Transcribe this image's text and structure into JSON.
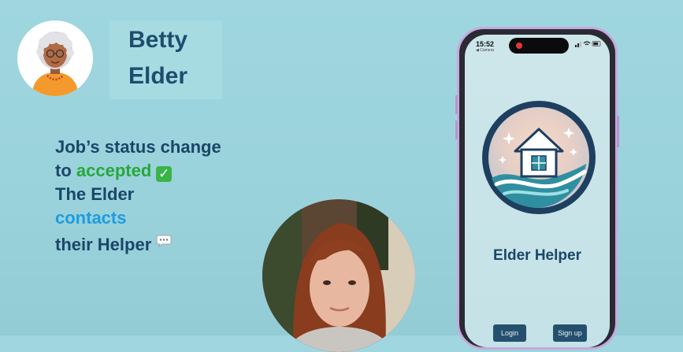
{
  "persona": {
    "first_name": "Betty",
    "last_name": "Elder"
  },
  "status_text": {
    "line1": "Job’s status change",
    "line2_prefix": "to ",
    "line2_highlight": "accepted",
    "line3": "The Elder",
    "line4": "contacts",
    "line5": "their Helper",
    "check_icon": "check-mark-button-emoji",
    "chat_icon": "speech-bubble-emoji"
  },
  "phone": {
    "status_bar": {
      "time": "15:52",
      "back_label": "◀ Camera"
    },
    "app_title": "Elder Helper",
    "buttons": {
      "login": "Login",
      "signup": "Sign up"
    }
  },
  "colors": {
    "background": "#9ad2dc",
    "heading": "#1e4d6e",
    "accepted": "#26a83a",
    "contacts": "#1f9ce0",
    "button": "#25506d"
  }
}
